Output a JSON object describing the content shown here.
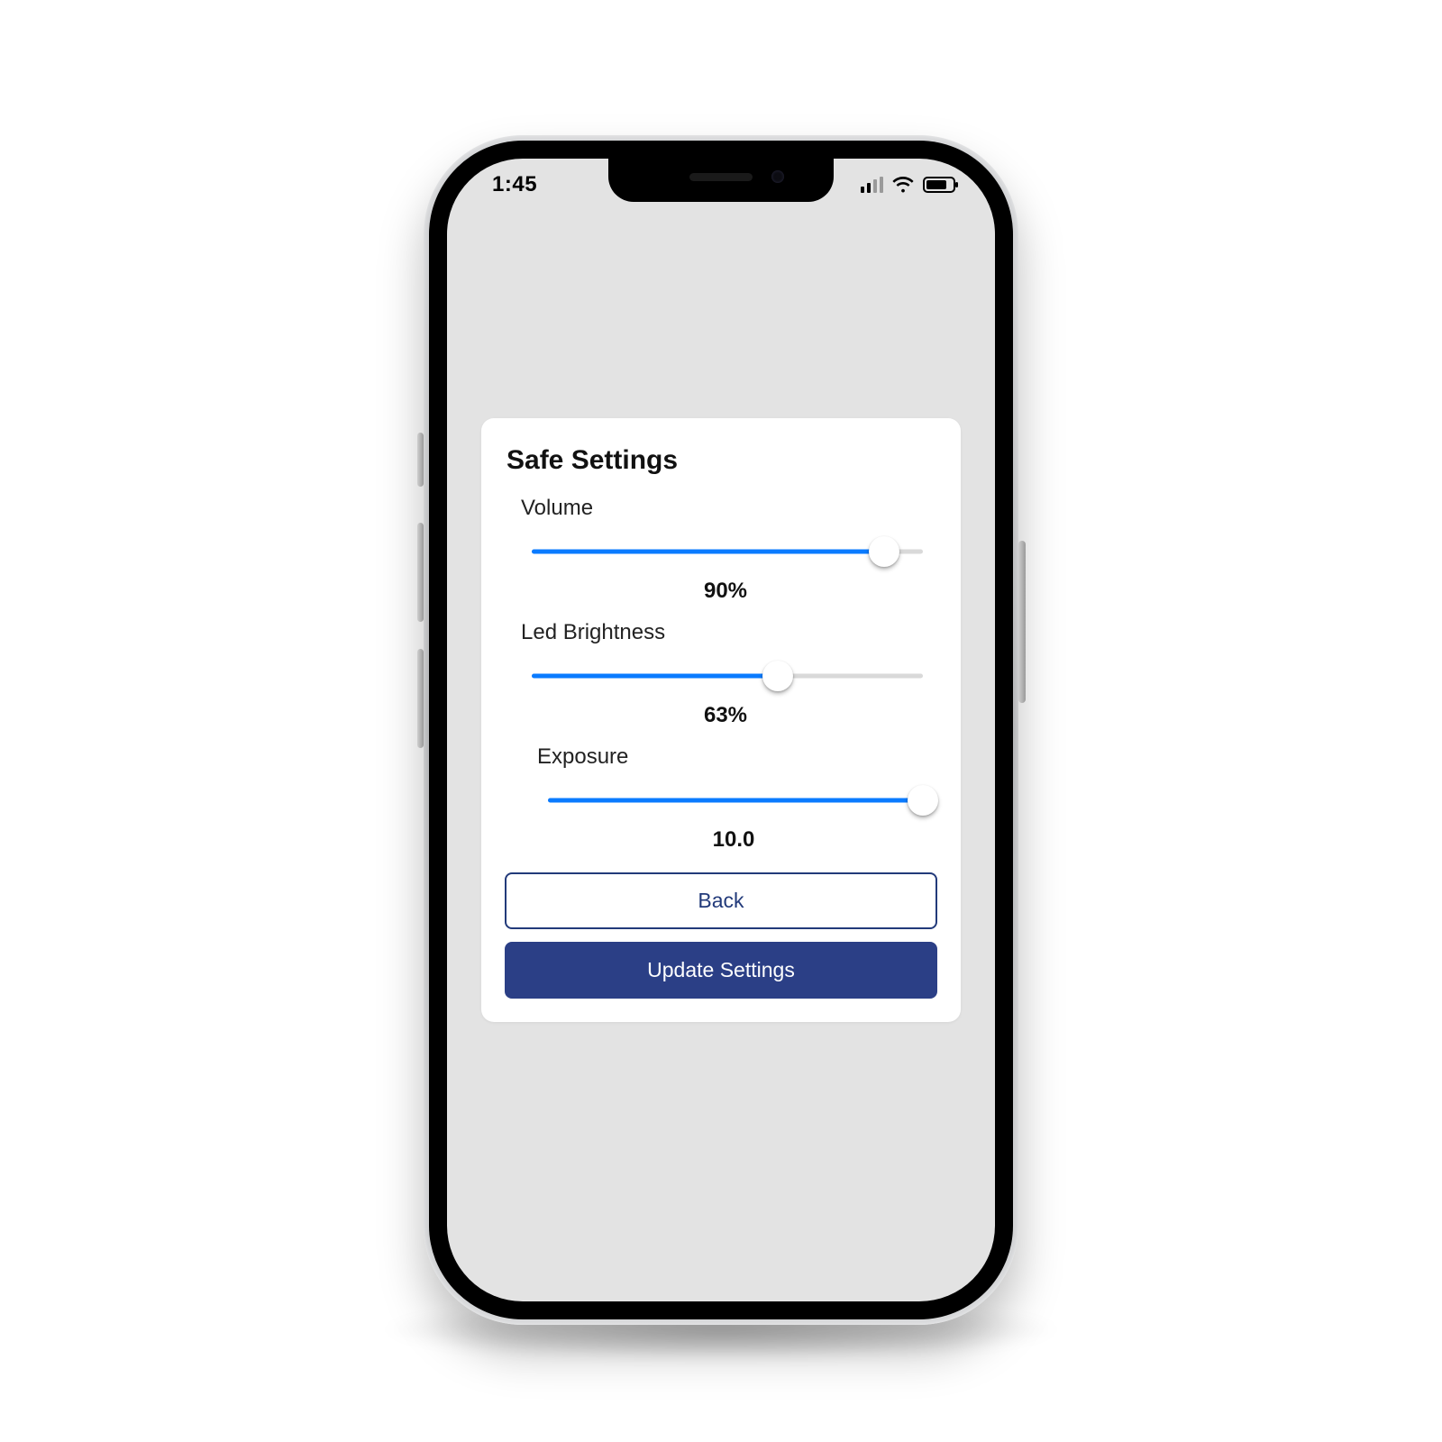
{
  "status": {
    "time": "1:45",
    "signal_bars_active": 2,
    "battery_percent": 70
  },
  "card": {
    "title": "Safe Settings",
    "settings": {
      "volume": {
        "label": "Volume",
        "value_text": "90%",
        "percent": 90
      },
      "brightness": {
        "label": "Led Brightness",
        "value_text": "63%",
        "percent": 63
      },
      "exposure": {
        "label": "Exposure",
        "value_text": "10.0",
        "percent": 100
      }
    },
    "buttons": {
      "back": "Back",
      "update": "Update Settings"
    }
  },
  "colors": {
    "accent_slider": "#0a7bff",
    "primary_button": "#2b3f86"
  }
}
